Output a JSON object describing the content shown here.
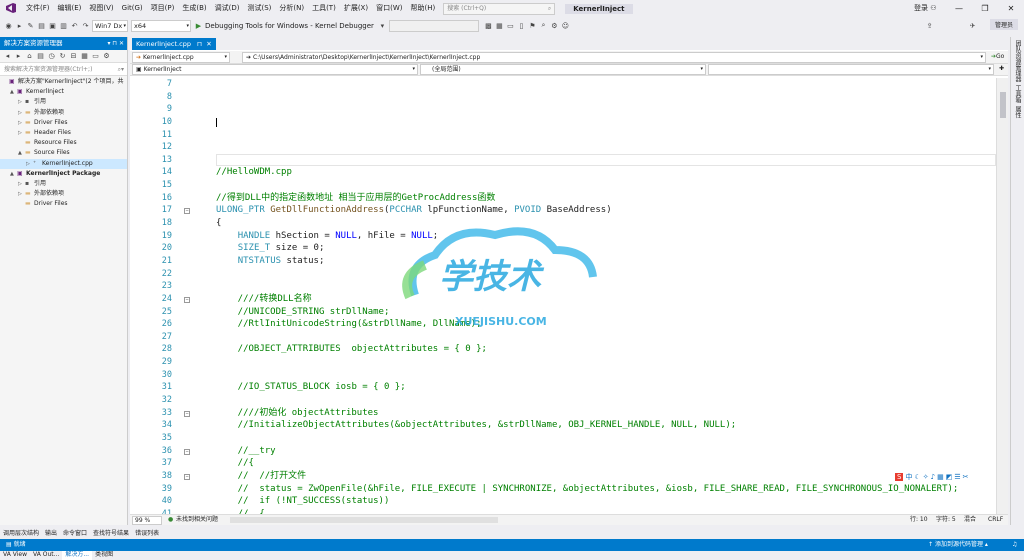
{
  "titlebar": {
    "logo": "vs-logo-icon",
    "menus": [
      "文件(F)",
      "编辑(E)",
      "视图(V)",
      "Git(G)",
      "项目(P)",
      "生成(B)",
      "调试(D)",
      "测试(S)",
      "分析(N)",
      "工具(T)",
      "扩展(X)",
      "窗口(W)",
      "帮助(H)"
    ],
    "search_placeholder": "搜索 (Ctrl+Q)",
    "app_title": "KernerlInject",
    "signin": "登录",
    "admin_badge": "管理员"
  },
  "toolbar": {
    "platform": "Win7 Dx",
    "arch": "x64",
    "debugger": "Debugging Tools for Windows - Kernel Debugger"
  },
  "solution_explorer": {
    "title": "解决方案资源管理器",
    "search_placeholder": "搜索解决方案资源管理器(Ctrl+;)",
    "tree": [
      {
        "label": "解决方案\"KernerlInject\"(2 个项目，共",
        "indent": 0,
        "arrow": "",
        "icon": "solution-icon"
      },
      {
        "label": "KernerlInject",
        "indent": 1,
        "arrow": "▲",
        "icon": "project-icon",
        "bold": false
      },
      {
        "label": "引用",
        "indent": 2,
        "arrow": "▷",
        "icon": "references-icon"
      },
      {
        "label": "外部依赖项",
        "indent": 2,
        "arrow": "▷",
        "icon": "folder-icon"
      },
      {
        "label": "Driver Files",
        "indent": 2,
        "arrow": "▷",
        "icon": "folder-icon"
      },
      {
        "label": "Header Files",
        "indent": 2,
        "arrow": "▷",
        "icon": "folder-icon"
      },
      {
        "label": "Resource Files",
        "indent": 2,
        "arrow": "",
        "icon": "folder-icon"
      },
      {
        "label": "Source Files",
        "indent": 2,
        "arrow": "▲",
        "icon": "folder-icon"
      },
      {
        "label": "KernerlInject.cpp",
        "indent": 3,
        "arrow": "▷",
        "icon": "cpp-file-icon",
        "selected": true
      },
      {
        "label": "KernerlInject Package",
        "indent": 1,
        "arrow": "▲",
        "icon": "project-icon",
        "bold": true
      },
      {
        "label": "引用",
        "indent": 2,
        "arrow": "▷",
        "icon": "references-icon"
      },
      {
        "label": "外部依赖项",
        "indent": 2,
        "arrow": "▷",
        "icon": "folder-icon"
      },
      {
        "label": "Driver Files",
        "indent": 2,
        "arrow": "",
        "icon": "folder-icon"
      }
    ],
    "tabs": [
      "VA View",
      "VA Out...",
      "解决方...",
      "类视图"
    ]
  },
  "editor": {
    "tab": "KernerlInject.cpp",
    "nav_file": "KernerlInject.cpp",
    "nav_path": "C:\\Users\\Administrator\\Desktop\\KernerlInject\\KernerlInject\\KernerlInject.cpp",
    "go_label": "Go",
    "scope_project": "KernerlInject",
    "scope_global": "(全局范围)",
    "lines": [
      {
        "n": "7",
        "t": ""
      },
      {
        "n": "8",
        "t": ""
      },
      {
        "n": "9",
        "t": ""
      },
      {
        "n": "10",
        "t": "",
        "cursor": true
      },
      {
        "n": "11",
        "t": ""
      },
      {
        "n": "12",
        "t": ""
      },
      {
        "n": "13",
        "t": ""
      },
      {
        "n": "14",
        "t": "//HelloWDM.cpp",
        "c": "cmt"
      },
      {
        "n": "15",
        "t": ""
      },
      {
        "n": "16",
        "t": "//得到DLL中的指定函数地址 相当于应用层的GetProcAddress函数",
        "c": "cmt"
      },
      {
        "n": "17",
        "t": "ULONG_PTR GetDllFunctionAddress(PCCHAR lpFunctionName, PVOID BaseAddress)",
        "c": "sig",
        "fold": "⊟"
      },
      {
        "n": "18",
        "t": "{"
      },
      {
        "n": "19",
        "t": "    HANDLE hSection = NULL, hFile = NULL;",
        "c": "decl1"
      },
      {
        "n": "20",
        "t": "    SIZE_T size = 0;",
        "c": "decl2"
      },
      {
        "n": "21",
        "t": "    NTSTATUS status;",
        "c": "decl3"
      },
      {
        "n": "22",
        "t": ""
      },
      {
        "n": "23",
        "t": ""
      },
      {
        "n": "24",
        "t": "    ////转换DLL名称",
        "c": "cmt",
        "fold": "⊟"
      },
      {
        "n": "25",
        "t": "    //UNICODE_STRING strDllName;",
        "c": "cmt"
      },
      {
        "n": "26",
        "t": "    //RtlInitUnicodeString(&strDllName, DllName);",
        "c": "cmt"
      },
      {
        "n": "27",
        "t": ""
      },
      {
        "n": "28",
        "t": "    //OBJECT_ATTRIBUTES  objectAttributes = { 0 };",
        "c": "cmt"
      },
      {
        "n": "29",
        "t": ""
      },
      {
        "n": "30",
        "t": ""
      },
      {
        "n": "31",
        "t": "    //IO_STATUS_BLOCK iosb = { 0 };",
        "c": "cmt"
      },
      {
        "n": "32",
        "t": ""
      },
      {
        "n": "33",
        "t": "    ////初始化 objectAttributes",
        "c": "cmt",
        "fold": "⊟"
      },
      {
        "n": "34",
        "t": "    //InitializeObjectAttributes(&objectAttributes, &strDllName, OBJ_KERNEL_HANDLE, NULL, NULL);",
        "c": "cmt"
      },
      {
        "n": "35",
        "t": ""
      },
      {
        "n": "36",
        "t": "    //__try",
        "c": "cmt",
        "fold": "⊟"
      },
      {
        "n": "37",
        "t": "    //{",
        "c": "cmt"
      },
      {
        "n": "38",
        "t": "    //  //打开文件",
        "c": "cmt",
        "fold": "⊟"
      },
      {
        "n": "39",
        "t": "    //  status = ZwOpenFile(&hFile, FILE_EXECUTE | SYNCHRONIZE, &objectAttributes, &iosb, FILE_SHARE_READ, FILE_SYNCHRONOUS_IO_NONALERT);",
        "c": "cmt"
      },
      {
        "n": "40",
        "t": "    //  if (!NT_SUCCESS(status))",
        "c": "cmt"
      },
      {
        "n": "41",
        "t": "    //  {",
        "c": "cmt"
      }
    ]
  },
  "editor_status": {
    "zoom": "99 %",
    "issues": "未找到相关问题",
    "line": "行: 10",
    "char": "字符: 5",
    "mode": "混合",
    "eol": "CRLF"
  },
  "right_tabs": [
    "团队资源管理器",
    "工具箱",
    "属性"
  ],
  "bottom_tabs": [
    "调用层次结构",
    "输出",
    "命令窗口",
    "查找符号结果",
    "错误列表"
  ],
  "status": {
    "text": "就绪",
    "source_control": "添加到源代码管理"
  },
  "watermark": {
    "text": "学技术",
    "url": "XUEJISHU.COM"
  },
  "colors": {
    "accent": "#007acc",
    "comment": "#008000",
    "keyword": "#0000ff",
    "type": "#2b91af",
    "chrome": "#eeeef2"
  }
}
